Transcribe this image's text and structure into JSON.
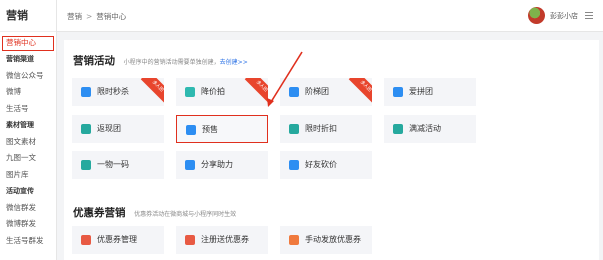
{
  "sidebar": {
    "brand": "营销",
    "items": [
      {
        "label": "营销中心",
        "type": "active"
      },
      {
        "label": "营销渠道",
        "type": "section"
      },
      {
        "label": "微信公众号",
        "type": "item"
      },
      {
        "label": "微博",
        "type": "item"
      },
      {
        "label": "生活号",
        "type": "item"
      },
      {
        "label": "素材管理",
        "type": "section"
      },
      {
        "label": "图文素材",
        "type": "item"
      },
      {
        "label": "九图一文",
        "type": "item"
      },
      {
        "label": "图片库",
        "type": "item"
      },
      {
        "label": "活动宣传",
        "type": "section"
      },
      {
        "label": "微信群发",
        "type": "item"
      },
      {
        "label": "微博群发",
        "type": "item"
      },
      {
        "label": "生活号群发",
        "type": "item"
      }
    ]
  },
  "header": {
    "breadcrumb": [
      "营销",
      "营销中心"
    ],
    "store_name": "彭彭小店",
    "avatar_icon": "user-avatar-icon",
    "menu_icon": "menu-icon"
  },
  "marketing": {
    "title": "营销活动",
    "desc": "小程序中的营销活动需要单独创建，",
    "link": "去创建>>",
    "cards": [
      {
        "label": "限时秒杀",
        "icon": "clock-icon",
        "color": "#2d8ef2",
        "badge": "多人团",
        "highlighted": false
      },
      {
        "label": "降价拍",
        "icon": "price-down-icon",
        "color": "#2fb9b0",
        "badge": "多人团",
        "highlighted": false
      },
      {
        "label": "阶梯团",
        "icon": "ladder-icon",
        "color": "#2d8ef2",
        "badge": "多人团",
        "highlighted": false
      },
      {
        "label": "爱拼团",
        "icon": "group-icon",
        "color": "#2d8ef2",
        "badge": "",
        "highlighted": false
      },
      {
        "label": "返现团",
        "icon": "cashback-icon",
        "color": "#26a99e",
        "badge": "",
        "highlighted": false
      },
      {
        "label": "预售",
        "icon": "presale-icon",
        "color": "#2d8ef2",
        "badge": "",
        "highlighted": true
      },
      {
        "label": "限时折扣",
        "icon": "discount-icon",
        "color": "#26a99e",
        "badge": "",
        "highlighted": false
      },
      {
        "label": "满减活动",
        "icon": "full-reduction-icon",
        "color": "#26a99e",
        "badge": "",
        "highlighted": false
      },
      {
        "label": "一物一码",
        "icon": "qrcode-icon",
        "color": "#26a99e",
        "badge": "",
        "highlighted": false
      },
      {
        "label": "分享助力",
        "icon": "share-icon",
        "color": "#2d8ef2",
        "badge": "",
        "highlighted": false
      },
      {
        "label": "好友砍价",
        "icon": "bargain-icon",
        "color": "#2d8ef2",
        "badge": "",
        "highlighted": false
      }
    ]
  },
  "coupons": {
    "title": "优惠券营销",
    "desc": "优惠券活动在微商城与小程序同时生效",
    "cards": [
      {
        "label": "优惠券管理",
        "icon": "coupon-icon",
        "color": "#e85a43"
      },
      {
        "label": "注册送优惠券",
        "icon": "register-coupon-icon",
        "color": "#e85a43"
      },
      {
        "label": "手动发放优惠券",
        "icon": "manual-coupon-icon",
        "color": "#f07a3e"
      }
    ]
  }
}
